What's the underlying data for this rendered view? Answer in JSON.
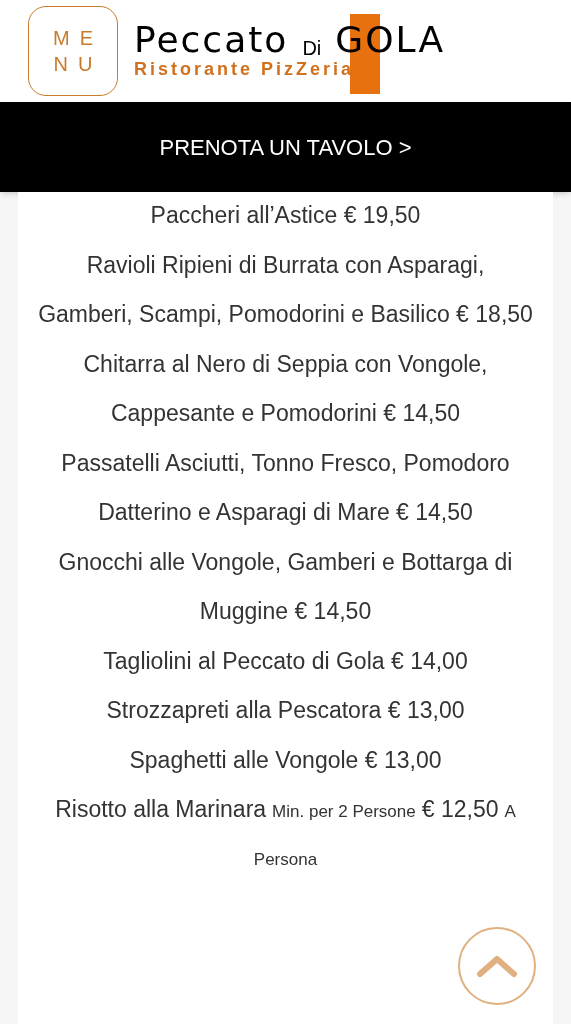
{
  "header": {
    "menu_button": {
      "line_1": "ME",
      "line_2": "NU"
    },
    "logo": {
      "title_1": "Peccato",
      "title_2": "Di",
      "title_3": "GOLA",
      "subtitle": "Ristorante PizZeria"
    }
  },
  "booking_bar": {
    "label": "PRENOTA UN TAVOLO >"
  },
  "dishes": [
    {
      "parts": [
        {
          "kind": "main",
          "text": "Paccheri all’Astice  € 19,50"
        }
      ]
    },
    {
      "parts": [
        {
          "kind": "main",
          "text": "Ravioli Ripieni di Burrata con Asparagi, Gamberi, Scampi, Pomodorini e Basilico  € 18,50"
        }
      ]
    },
    {
      "parts": [
        {
          "kind": "main",
          "text": "Chitarra al Nero di Seppia con Vongole, Cappesante e Pomodorini € 14,50"
        }
      ]
    },
    {
      "parts": [
        {
          "kind": "main",
          "text": "Passatelli Asciutti, Tonno Fresco, Pomodoro Datterino e Asparagi di Mare  € 14,50"
        }
      ]
    },
    {
      "parts": [
        {
          "kind": "main",
          "text": "Gnocchi alle Vongole, Gamberi e Bottarga di Muggine  € 14,50"
        }
      ]
    },
    {
      "parts": [
        {
          "kind": "main",
          "text": "Tagliolini al Peccato di Gola  € 14,00"
        }
      ]
    },
    {
      "parts": [
        {
          "kind": "main",
          "text": "Strozzapreti alla Pescatora  €  13,00"
        }
      ]
    },
    {
      "parts": [
        {
          "kind": "main",
          "text": "Spaghetti alle Vongole  € 13,00"
        }
      ]
    },
    {
      "parts": [
        {
          "kind": "main",
          "text": "Risotto alla Marinara"
        },
        {
          "kind": "note",
          "text": "Min. per 2 Persone"
        },
        {
          "kind": "main",
          "text": "€ 12,50"
        },
        {
          "kind": "note",
          "text": "A Persona"
        }
      ]
    }
  ]
}
